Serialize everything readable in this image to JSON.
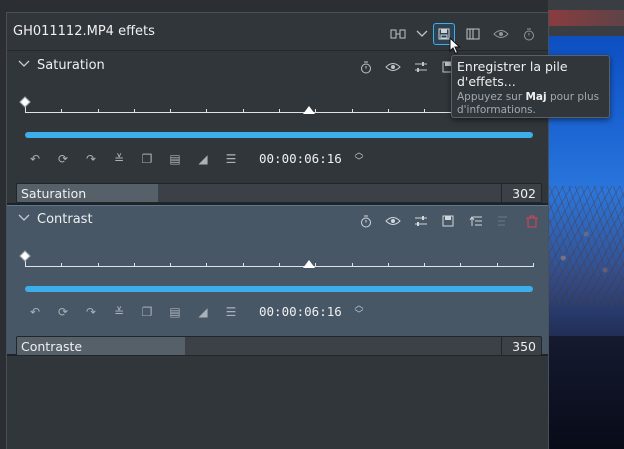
{
  "panel": {
    "title": "GH011112.MP4 effets",
    "header_icons": [
      "compare-icon",
      "chevron-down-icon",
      "save-stack-icon",
      "split-view-icon",
      "eye-icon",
      "timer-icon"
    ]
  },
  "effects": [
    {
      "title": "Saturation",
      "timecode": "00:00:06:16",
      "param_label": "Saturation",
      "param_value": "302",
      "param_fill": 0.27
    },
    {
      "title": "Contrast",
      "timecode": "00:00:06:16",
      "param_label": "Contraste",
      "param_value": "350",
      "param_fill": 0.32
    }
  ],
  "tooltip": {
    "title": "Enregistrer la pile d'effets...",
    "hint_prefix": "Appuyez sur ",
    "hint_key": "Maj",
    "hint_suffix": " pour plus d'informations."
  },
  "colors": {
    "accent": "#3daee9",
    "panel": "#31363b",
    "selected_effect": "#475766",
    "delete": "#da4453"
  }
}
